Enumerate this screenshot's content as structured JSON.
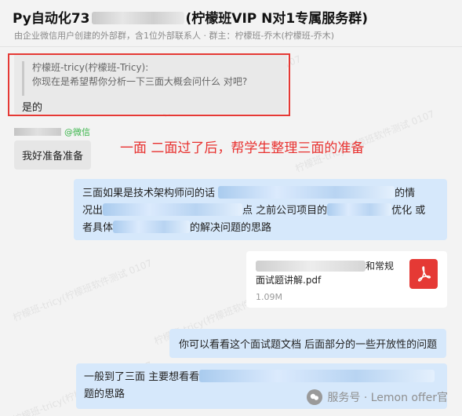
{
  "header": {
    "title_prefix": "Py自动化73",
    "title_suffix": "(柠檬班VIP N对1专属服务群)",
    "subtitle": "由企业微信用户创建的外部群，含1位外部联系人 · 群主：柠檬班-乔木(柠檬班-乔木)"
  },
  "quote_message": {
    "quoted_sender": "柠檬班-tricy(柠檬班-Tricy):",
    "quoted_text": "你现在是希望帮你分析一下三面大概会问什么 对吧?",
    "reply": "是的"
  },
  "sender": {
    "source_tag": "@微信"
  },
  "msg_prepare": "我好准备准备",
  "annotation": "一面 二面过了后，帮学生整理三面的准备",
  "msg_architect": {
    "line1_a": "三面如果是技术架构师问的话",
    "line1_b": "的情",
    "line2_a": "况出",
    "line2_b": "点 之前公司项目的",
    "line2_c": "优化 或",
    "line3_a": "者具体",
    "line3_b": "的解决问题的思路"
  },
  "file": {
    "name_suffix": "和常规",
    "name_line2": "面试题讲解.pdf",
    "size": "1.09M"
  },
  "msg_doc": "你可以看看这个面试题文档 后面部分的一些开放性的问题",
  "msg_third": {
    "line1": "一般到了三面 主要想看看",
    "line2": "题的思路"
  },
  "watermark": {
    "text": "服务号 · Lemon offer官"
  },
  "bg_watermark": "柠檬班-tricy(柠檬班软件测试 0107"
}
